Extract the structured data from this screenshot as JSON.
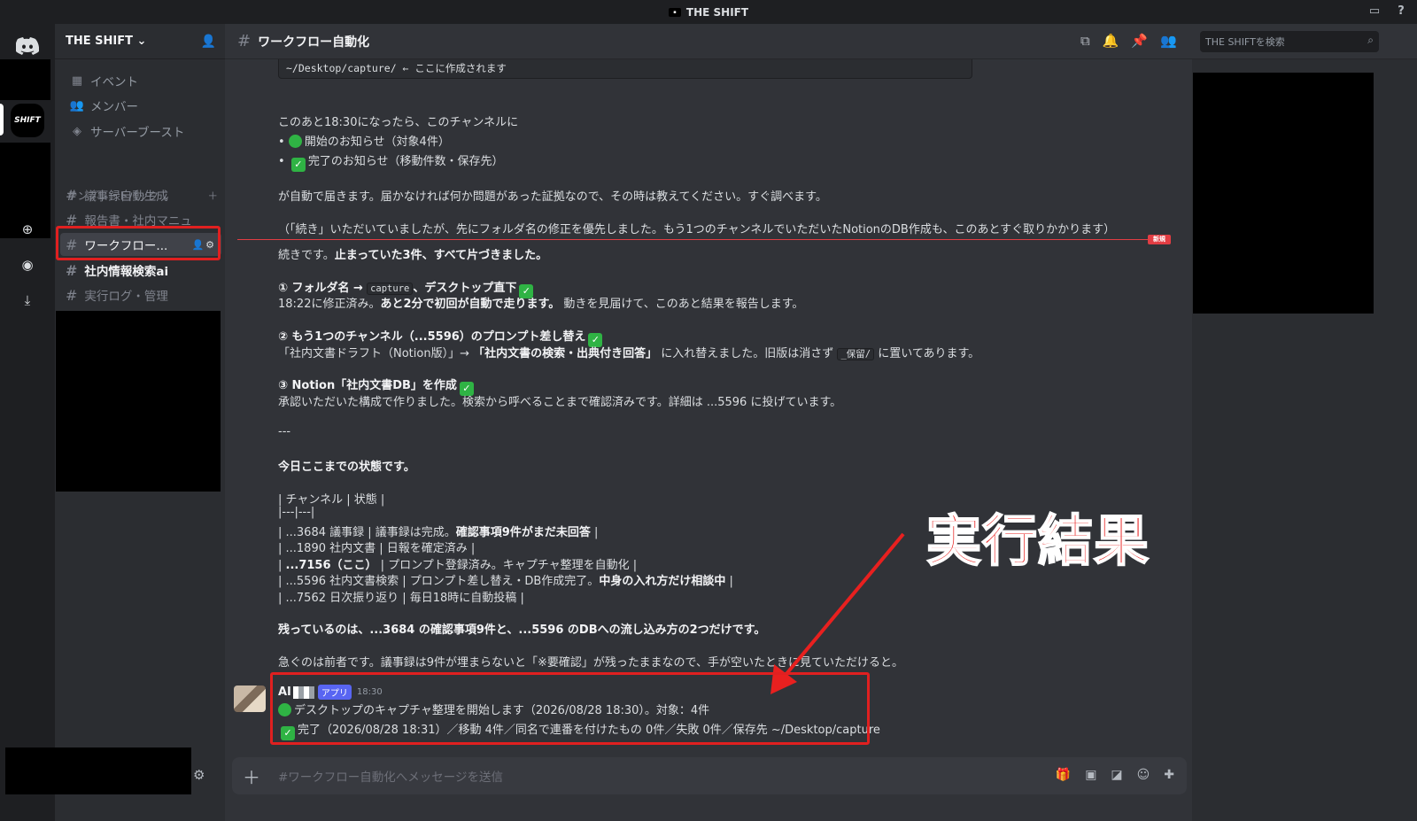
{
  "window": {
    "title": "THE SHIFT"
  },
  "rail": {
    "server_label": "SHIFT"
  },
  "sidebar": {
    "guild_name": "THE SHIFT ⌄",
    "nav": [
      {
        "label": "イベント",
        "icon": "calendar-icon"
      },
      {
        "label": "メンバー",
        "icon": "members-icon"
      },
      {
        "label": "サーバーブースト",
        "icon": "boost-icon"
      }
    ],
    "category": "テンプレートパック ⌄",
    "channels": [
      {
        "label": "議事録自動生成"
      },
      {
        "label": "報告書・社内マニュ"
      },
      {
        "label": "ワークフロー..."
      },
      {
        "label": "社内情報検索ai"
      },
      {
        "label": "実行ログ・管理"
      }
    ]
  },
  "header": {
    "channel_name": "ワークフロー自動化",
    "search_placeholder": "THE SHIFTを検索"
  },
  "messages": {
    "code_line": "~/Desktop/capture/  ← ここに作成されます",
    "l1": "このあと18:30になったら、このチャンネルに",
    "b1": "開始のお知らせ（対象4件）",
    "b2": "完了のお知らせ（移動件数・保存先）",
    "l2": "が自動で届きます。届かなければ何か問題があった証拠なので、その時は教えてください。すぐ調べます。",
    "l3": "（「続き」いただいていましたが、先にフォルダ名の修正を優先しました。もう1つのチャンネルでいただいたNotionのDB作成も、このあとすぐ取りかかります）",
    "new_badge": "新規",
    "l4a": "続きです。",
    "l4b": "止まっていた3件、すべて片づきました。",
    "s1_title_a": "① フォルダ名 →",
    "s1_code": "capture",
    "s1_title_b": "、デスクトップ直下",
    "s1_body_a": "18:22に修正済み。",
    "s1_body_b": "あと2分で初回が自動で走ります。",
    "s1_body_c": "動きを見届けて、このあと結果を報告します。",
    "s2_title": "② もう1つのチャンネル（...5596）のプロンプト差し替え",
    "s2_body_a": "「社内文書ドラフト（Notion版）」→",
    "s2_body_b": "「社内文書の検索・出典付き回答」",
    "s2_body_c": "に入れ替えました。旧版は消さず",
    "s2_code": "_保留/",
    "s2_body_d": "に置いてあります。",
    "s3_title": "③ Notion「社内文書DB」を作成",
    "s3_body": "承認いただいた構成で作りました。検索から呼べることまで確認済みです。詳細は ...5596 に投げています。",
    "sep": "---",
    "status_title": "今日ここまでの状態です。",
    "t0": "| チャンネル | 状態 |",
    "t1": "|---|---|",
    "t2a": "| ...3684 議事録 | 議事録は完成。",
    "t2b": "確認事項9件がまだ未回答",
    "t2c": " |",
    "t3": "| ...1890 社内文書 | 日報を確定済み |",
    "t4a": "| ",
    "t4b": "...7156（ここ）",
    "t4c": " | プロンプト登録済み。キャプチャ整理を自動化 |",
    "t5a": "| ...5596 社内文書検索 | プロンプト差し替え・DB作成完了。",
    "t5b": "中身の入れ方だけ相談中",
    "t5c": " |",
    "t6": "| ...7562 日次振り返り | 毎日18時に自動投稿 |",
    "remain": "残っているのは、...3684 の確認事項9件と、...5596 のDBへの流し込み方の2つだけです。",
    "urgent": "急ぐのは前者です。議事録は9件が埋まらないと「※要確認」が残ったままなので、手が空いたときに見ていただけると。"
  },
  "bot_message": {
    "author": "AI",
    "badge": "アプリ",
    "time": "18:30",
    "line1": "デスクトップのキャプチャ整理を開始します（2026/08/28 18:30）。対象：4件",
    "line2": "完了（2026/08/28 18:31）／移動 4件／同名で連番を付けたもの 0件／失敗 0件／保存先 ~/Desktop/capture"
  },
  "annotation": {
    "label": "実行結果"
  },
  "composer": {
    "placeholder": "#ワークフロー自動化へメッセージを送信"
  },
  "colors": {
    "accent": "#5865f2",
    "annotation_red": "#e8201f",
    "success": "#2fb344"
  }
}
